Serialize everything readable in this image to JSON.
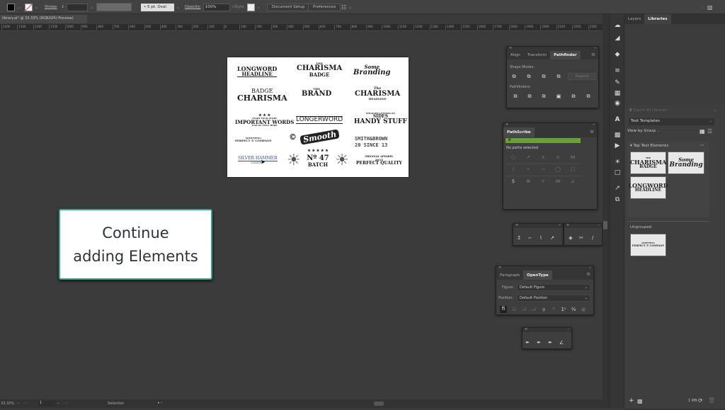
{
  "control_bar": {
    "stroke_label": "Stroke",
    "brush_value": "5 pt. Oval",
    "opacity_label": "Opacity:",
    "opacity_value": "100%",
    "style_label": "Style",
    "document_setup": "Document Setup",
    "preferences": "Preferences"
  },
  "document_tab": "library.ai* @ 33.33% (RGB/GPU Preview)",
  "ruler_ticks": [
    "1400",
    "1300",
    "1200",
    "1100",
    "1000",
    "900",
    "800",
    "700",
    "600",
    "500",
    "400",
    "300",
    "200",
    "100",
    "0",
    "100",
    "200",
    "300",
    "400",
    "500",
    "600",
    "700",
    "800",
    "900",
    "1000",
    "1100",
    "1200",
    "1300",
    "1400",
    "1500",
    "1600",
    "1700",
    "1800",
    "1900",
    "2000",
    "2100",
    "2200",
    "2300"
  ],
  "artboard_logos": [
    {
      "lines": [
        "LONGWORD",
        "HEADLINE"
      ]
    },
    {
      "lines": [
        "THE",
        "CHARISMA",
        "BADGE"
      ]
    },
    {
      "lines": [
        "Some",
        "Branding"
      ]
    },
    {
      "lines": [
        "BADGE",
        "CHARISMA"
      ]
    },
    {
      "lines": [
        "THE",
        "BRAND"
      ]
    },
    {
      "lines": [
        "The",
        "CHARISMA",
        "HEADLINE"
      ]
    },
    {
      "lines": [
        "START YOUR STORY",
        "IMPORTANT WORDS",
        "END OF TITLE HERE"
      ]
    },
    {
      "lines": [
        "LONGERWORD"
      ]
    },
    {
      "lines": [
        "STRAIGHT LETTERS ON",
        "SIDES",
        "HANDY STUFF"
      ]
    },
    {
      "lines": [
        "SOMETHING",
        "PERFECT © COMPANY"
      ]
    },
    {
      "lines": [
        "©",
        "Smooth"
      ]
    },
    {
      "lines": [
        "SMITH&BROWN",
        "20 SINCE 13"
      ]
    },
    {
      "lines": [
        "SILVER HAMMER",
        "LIMITED"
      ]
    },
    {
      "lines": [
        "Nº 47",
        "BATCH"
      ]
    },
    {
      "lines": [
        "ORIGINAL APPAREL",
        "2015",
        "PERFECT QUALITY"
      ]
    }
  ],
  "callout": {
    "line1": "Continue",
    "line2": "adding Elements"
  },
  "pathfinder_panel": {
    "tabs": [
      "Align",
      "Transform",
      "Pathfinder"
    ],
    "active_tab": "Pathfinder",
    "shape_modes_label": "Shape Modes:",
    "expand_label": "Expand",
    "pathfinders_label": "Pathfinders:"
  },
  "pathscribe_panel": {
    "title": "PathScribe",
    "status": "No paths selected",
    "accent": "#6aa22b"
  },
  "opentype_panel": {
    "tabs": [
      "Paragraph",
      "OpenType"
    ],
    "active_tab": "OpenType",
    "figure_label": "Figure:",
    "figure_value": "Default Figure",
    "position_label": "Position:",
    "position_value": "Default Position"
  },
  "libraries_panel": {
    "tabs": [
      "Layers",
      "Libraries"
    ],
    "active_tab": "Libraries",
    "search_placeholder": "Search All Libraries",
    "library_select": "Text Templates",
    "view_by": "View by Group",
    "group_title": "Top Text Elements",
    "group_items": [
      {
        "lines": [
          "THE",
          "CHARISMA",
          "BADGE"
        ]
      },
      {
        "lines": [
          "Some",
          "Branding"
        ]
      },
      {
        "lines": [
          "LONGWORD",
          "HEADLINE"
        ]
      }
    ],
    "ungrouped_title": "Ungrouped",
    "ungrouped_items": [
      {
        "lines": [
          "SOMETHING",
          "PERFECT © COMPANY"
        ]
      }
    ],
    "storage": "1 MB"
  },
  "status_bar": {
    "zoom": "33.33%",
    "artboard": "1",
    "tool": "Selection"
  }
}
